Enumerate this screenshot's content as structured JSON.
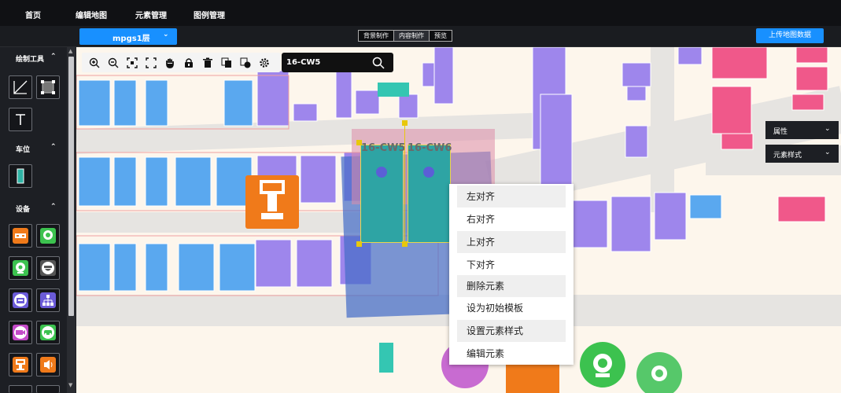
{
  "nav": {
    "items": [
      "首页",
      "编辑地图",
      "元素管理",
      "图例管理"
    ]
  },
  "toolbar": {
    "floor": "mpgs1层",
    "mode_tabs": [
      "背景制作",
      "内容制作",
      "预览"
    ],
    "active_mode": "内容制作",
    "upload_label": "上传地图数据"
  },
  "sidebar": {
    "sections": [
      {
        "title": "绘制工具",
        "tools": [
          "line-tool-icon",
          "rect-tool-icon",
          "text-tool-icon"
        ]
      },
      {
        "title": "车位",
        "tools": [
          "parking-space-icon"
        ]
      },
      {
        "title": "设备",
        "tools": [
          "led-screen-icon",
          "location-beacon-icon",
          "camera-icon",
          "dome-camera-icon",
          "phone-icon",
          "network-icon",
          "video-camera-icon",
          "car-detector-icon",
          "guide-screen-icon",
          "speaker-icon"
        ]
      }
    ]
  },
  "map_toolbar": {
    "icons": [
      "zoom-in-icon",
      "zoom-out-icon",
      "fit-icon",
      "fullscreen-icon",
      "hand-icon",
      "lock-icon",
      "delete-icon",
      "copy-icon",
      "paste-icon",
      "settings-icon"
    ],
    "search_value": "16-CW5"
  },
  "right_panels": {
    "attributes": "属性",
    "element_style": "元素样式"
  },
  "selection": {
    "labels": [
      "16-CW5",
      "16-CW6"
    ]
  },
  "context_menu": {
    "items": [
      "左对齐",
      "右对齐",
      "上对齐",
      "下对齐",
      "删除元素",
      "设为初始模板",
      "设置元素样式",
      "编辑元素"
    ]
  },
  "colors": {
    "parking_blue": "#5aa8ef",
    "parking_purple": "#9e86ec",
    "parking_pink": "#f0588a",
    "accent": "#1890ff"
  }
}
